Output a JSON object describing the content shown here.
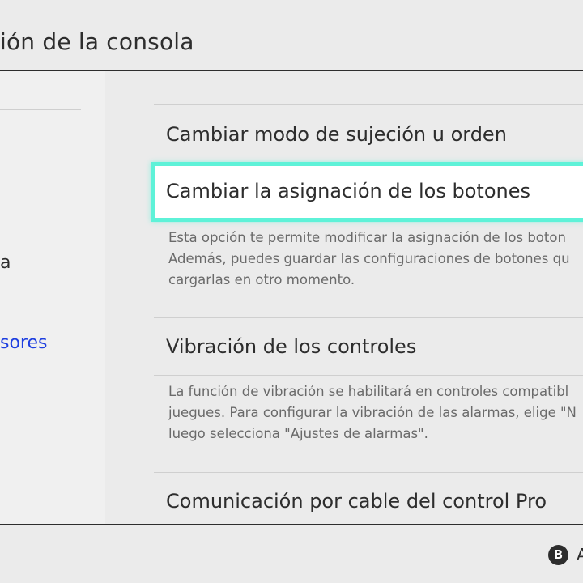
{
  "header": {
    "title": "ión de la consola"
  },
  "sidebar": {
    "items": [
      {
        "label": "a",
        "active": false
      },
      {
        "label": "sores",
        "active": true
      }
    ]
  },
  "main": {
    "items": [
      {
        "label": "Cambiar modo de sujeción u orden"
      },
      {
        "label": "Cambiar la asignación de los botones",
        "selected": true,
        "description": [
          "Esta opción te permite modificar la asignación de los boton",
          "Además, puedes guardar las configuraciones de botones qu",
          "cargarlas en otro momento."
        ]
      },
      {
        "label": "Vibración de los controles",
        "description": [
          "La función de vibración se habilitará en controles compatibl",
          " juegues. Para configurar la vibración de las alarmas, elige \"N",
          "luego selecciona \"Ajustes de alarmas\"."
        ]
      },
      {
        "label": "Comunicación por cable del control Pro"
      }
    ]
  },
  "footer": {
    "back_button_glyph": "B",
    "back_label": "A"
  },
  "colors": {
    "background": "#ebebeb",
    "selection_border": "#5ef2d8",
    "active_text": "#1e3fe0"
  }
}
